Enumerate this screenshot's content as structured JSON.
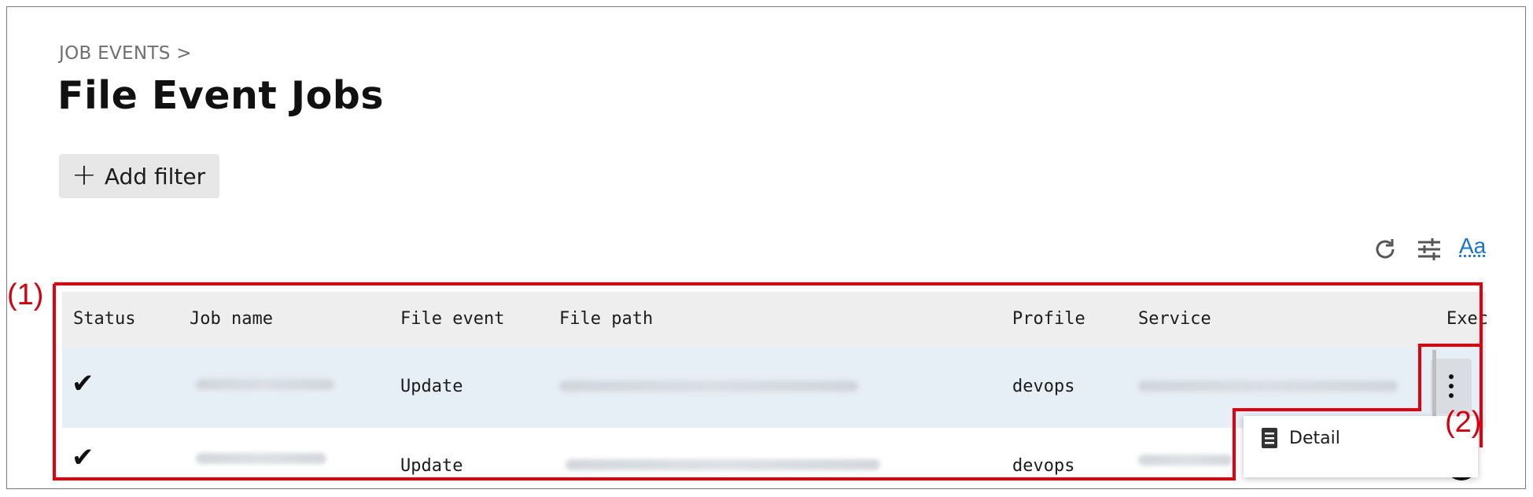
{
  "breadcrumb": "JOB EVENTS >",
  "page_title": "File Event Jobs",
  "add_filter": {
    "label": "Add filter",
    "icon": "plus-icon"
  },
  "toolbar": {
    "icons": [
      "refresh-icon",
      "sliders-icon",
      "text-size-icon"
    ],
    "text_size_label": "Aa"
  },
  "table": {
    "columns": [
      "Status",
      "Job name",
      "File event",
      "File path",
      "Profile",
      "Service",
      "Exec"
    ],
    "rows": [
      {
        "status_icon": "check-icon",
        "file_event": "Update",
        "profile": "devops"
      },
      {
        "status_icon": "check-icon",
        "file_event": "Update",
        "profile": "devops"
      }
    ]
  },
  "row_menu": {
    "items": [
      {
        "label": "Detail",
        "icon": "document-icon"
      }
    ]
  },
  "callouts": [
    "(1)",
    "(2)"
  ],
  "colors": {
    "callout": "#e00010",
    "header_bg": "#eeeeee",
    "selected_row_bg": "#e6eef6",
    "accent": "#1a73c8"
  }
}
